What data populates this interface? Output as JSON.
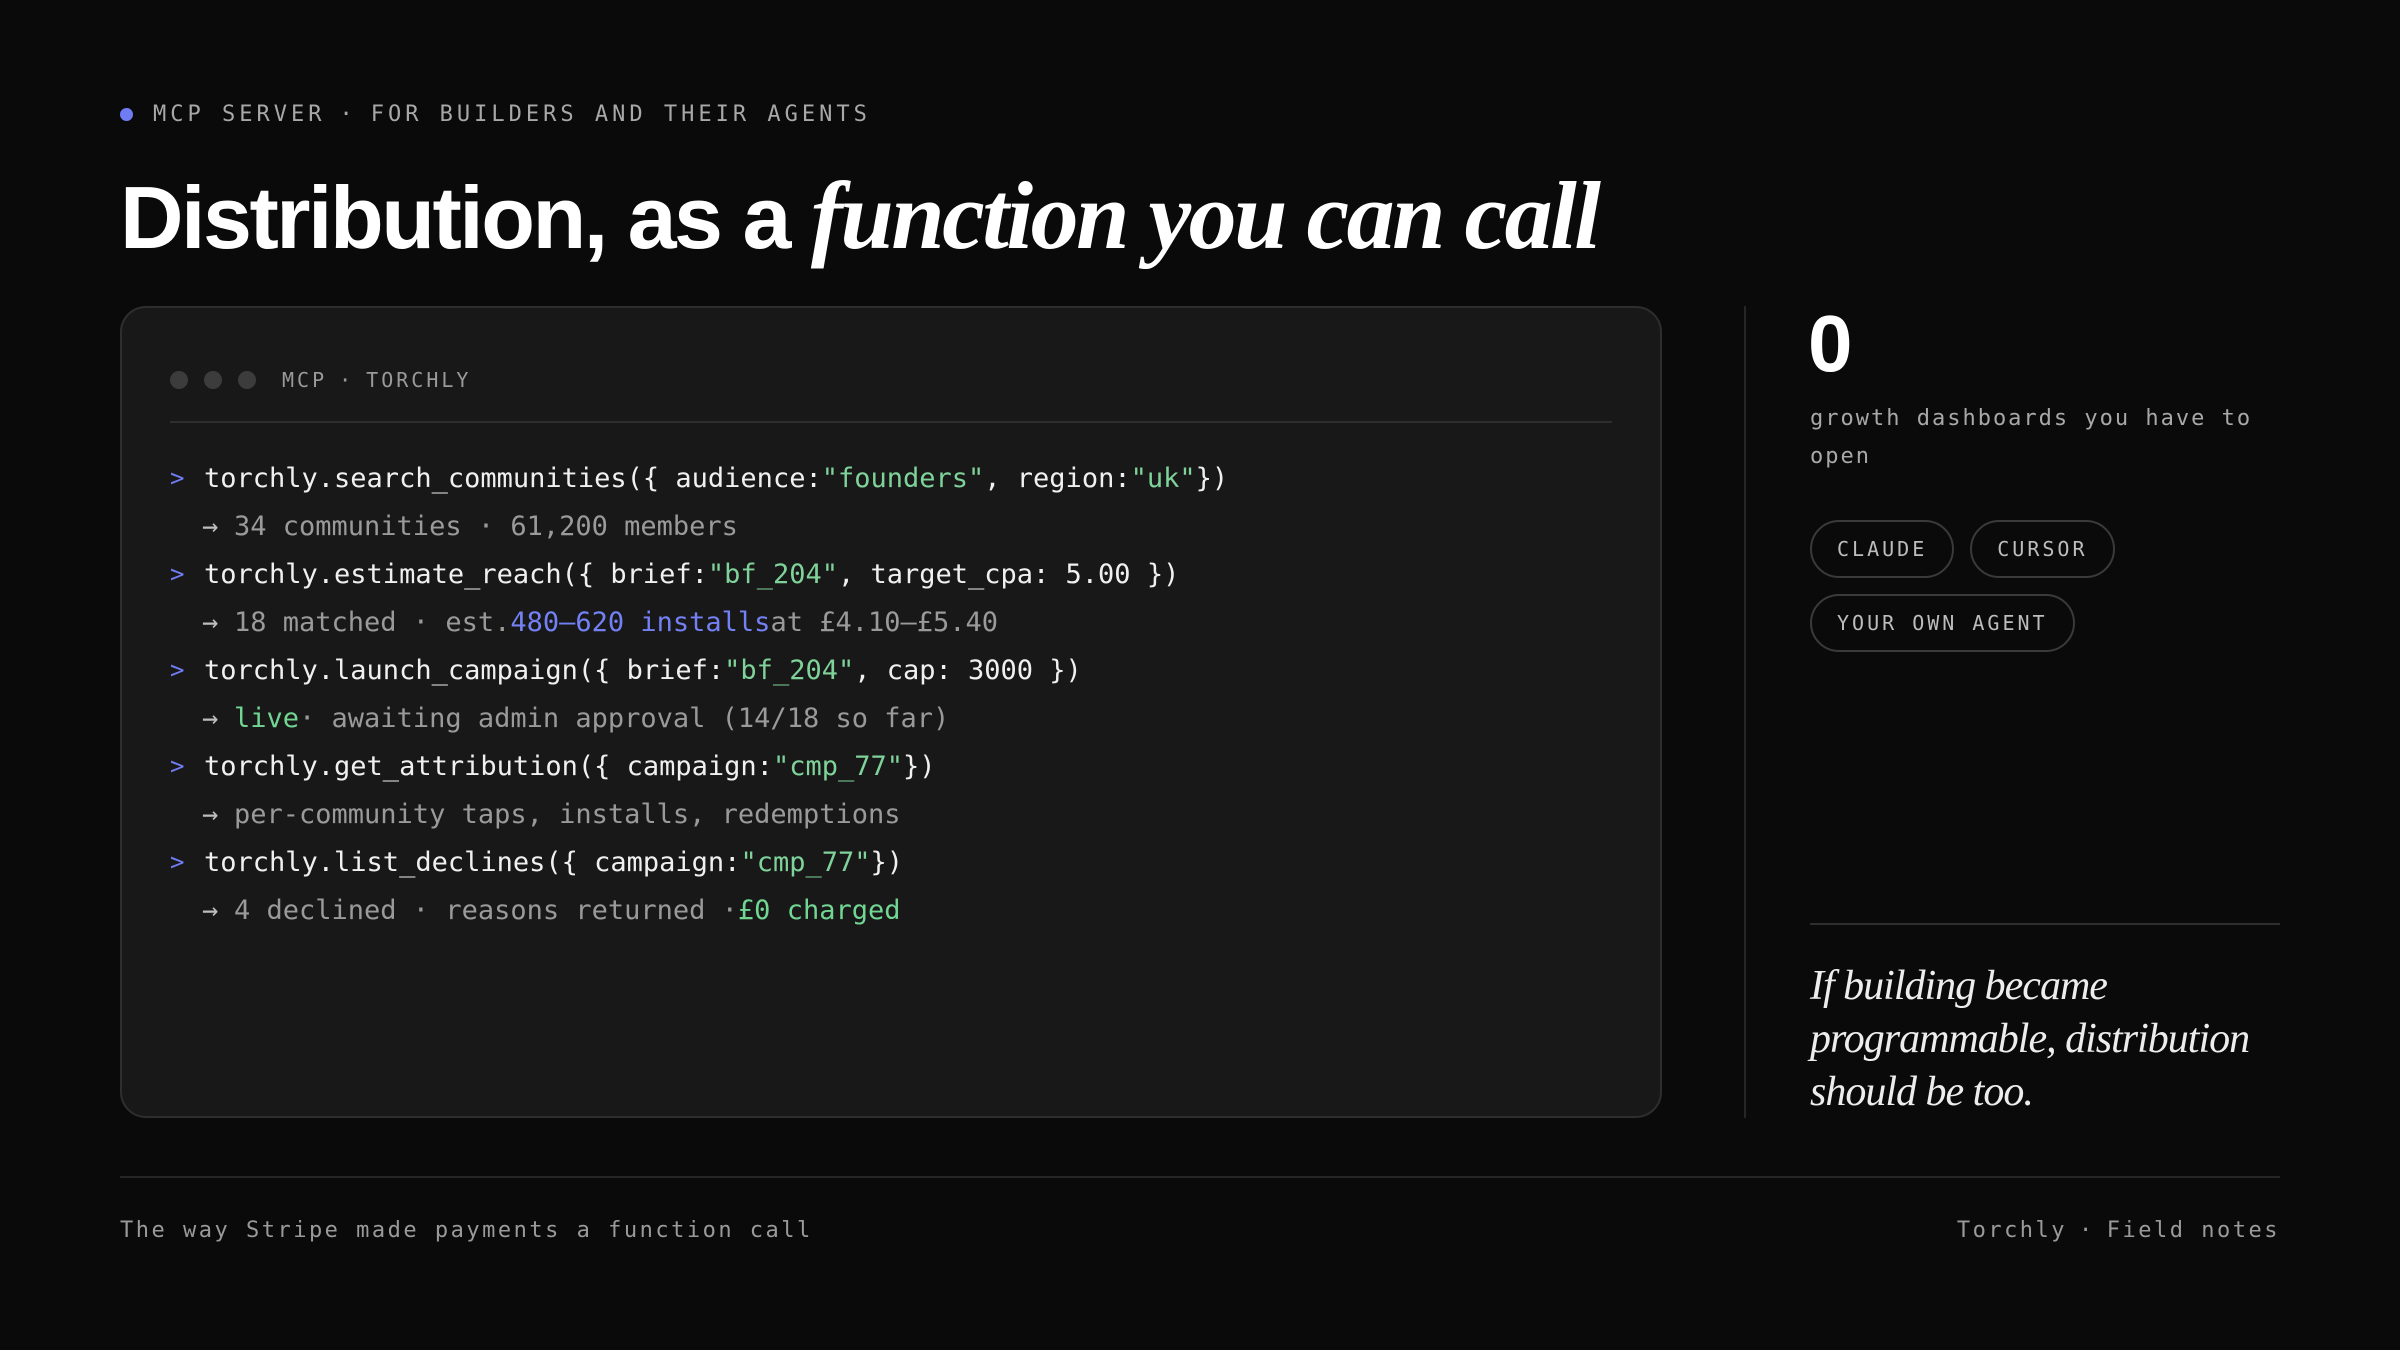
{
  "eyebrow": {
    "part1": "MCP SERVER",
    "separator": "·",
    "part2": "FOR BUILDERS AND THEIR AGENTS",
    "dot_color": "#6f7cf4"
  },
  "headline": {
    "plain": "Distribution, as a",
    "italic": "function you can call"
  },
  "terminal": {
    "header_left": "MCP",
    "header_separator": "·",
    "header_right": "TORCHLY",
    "prompt_glyph": ">",
    "arrow_glyph": "→",
    "lines": [
      {
        "cmd": {
          "t1": "torchly.search_communities({ audience: ",
          "s1": "\"founders\"",
          "t2": ", region: ",
          "s2": "\"uk\"",
          "t3": " })"
        },
        "out": {
          "t1": "34 communities · 61,200 members"
        }
      },
      {
        "cmd": {
          "t1": "torchly.estimate_reach({ brief: ",
          "s1": "\"bf_204\"",
          "t2": ", target_cpa: 5.00 })"
        },
        "out": {
          "t1": "18 matched · est. ",
          "hl": "480–620 installs",
          "t2": " at £4.10–£5.40"
        }
      },
      {
        "cmd": {
          "t1": "torchly.launch_campaign({ brief: ",
          "s1": "\"bf_204\"",
          "t2": ", cap: 3000 })"
        },
        "out": {
          "hl": "live",
          "t1": " · awaiting admin approval (14/18 so far)"
        }
      },
      {
        "cmd": {
          "t1": "torchly.get_attribution({ campaign: ",
          "s1": "\"cmp_77\"",
          "t2": " })"
        },
        "out": {
          "t1": "per-community taps, installs, redemptions"
        }
      },
      {
        "cmd": {
          "t1": "torchly.list_declines({ campaign: ",
          "s1": "\"cmp_77\"",
          "t2": " })"
        },
        "out": {
          "t1": "4 declined · reasons returned · ",
          "hl": "£0 charged"
        }
      }
    ]
  },
  "stat": {
    "number": "0",
    "label": "growth dashboards you have to open"
  },
  "chips": [
    "CLAUDE",
    "CURSOR",
    "YOUR OWN AGENT"
  ],
  "quote": "If building became programmable, distribution should be too.",
  "footer": {
    "left": "The way Stripe made payments a function call",
    "right_brand": "Torchly",
    "right_separator": "·",
    "right_section": "Field notes"
  },
  "colors": {
    "background": "#0a0a0a",
    "card": "#181818",
    "accent_blue": "#6f7cf4",
    "string_green": "#7fd39a",
    "success_green": "#72d693"
  }
}
